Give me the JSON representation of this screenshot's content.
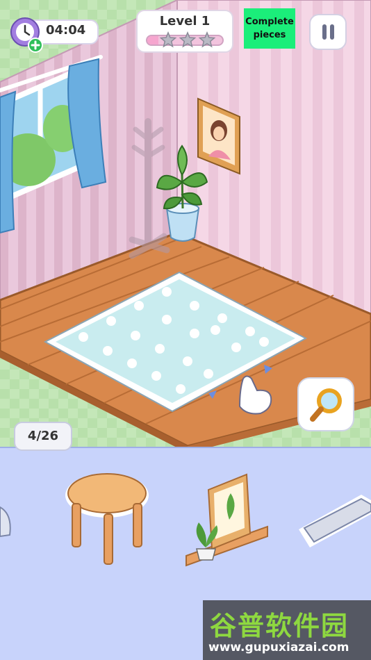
{
  "hud": {
    "timer": "04:04",
    "level_label": "Level 1",
    "level_progress": 0.15,
    "stars_total": 3,
    "stars_earned": 0,
    "complete_button": "Complete\npieces",
    "pause_icon": "pause-icon",
    "timer_icon": "clock-icon",
    "add_time_icon": "plus-icon"
  },
  "pieces_counter": "4/26",
  "tray": {
    "items": [
      "partial-item-left",
      "wooden-stool",
      "plant-frame-shelf",
      "keyboard"
    ]
  },
  "scene": {
    "items": [
      "window-with-curtains",
      "coat-rack",
      "framed-portrait",
      "potted-plant",
      "blue-flower-rug",
      "pointing-hand"
    ]
  },
  "zoom_icon": "magnifier-icon",
  "watermark": {
    "title": "谷普软件园",
    "url": "www.gupuxiazai.com"
  },
  "colors": {
    "complete_button": "#1bee7a",
    "tray": "#c8d3fb",
    "floor": "#d9884c",
    "wall": "#f2d1e0",
    "rug": "#c9ecef"
  }
}
